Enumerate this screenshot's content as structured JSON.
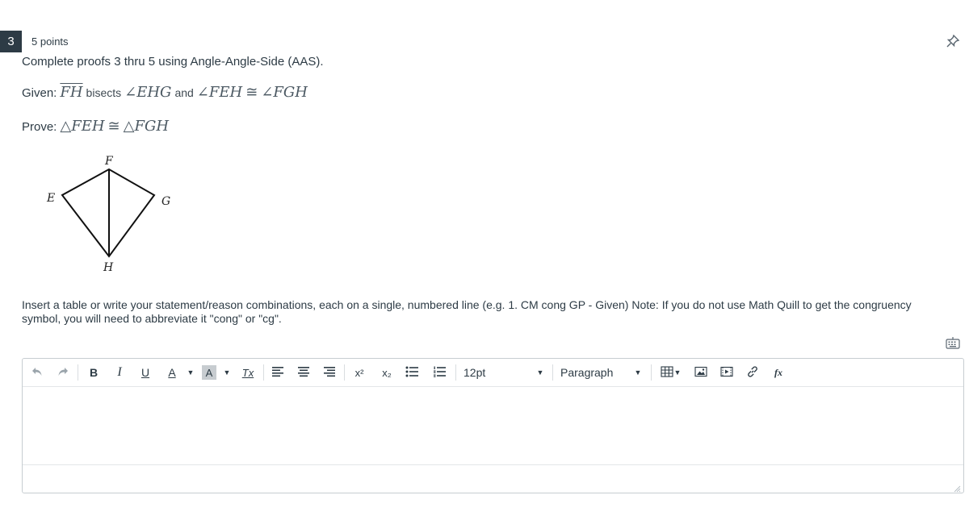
{
  "question": {
    "number": "3",
    "points": "5 points",
    "title": "Complete proofs 3 thru 5 using Angle-Angle-Side (AAS).",
    "given": {
      "label": "Given:",
      "segment": "FH",
      "word_bisects": "bisects",
      "angle1": "∠EHG",
      "word_and": "and",
      "angle2": "∠FEH",
      "congruent": "≅",
      "angle3": "∠FGH"
    },
    "prove": {
      "label": "Prove:",
      "tri1": "△FEH",
      "congruent": "≅",
      "tri2": "△FGH"
    },
    "diagram_labels": {
      "F": "F",
      "E": "E",
      "G": "G",
      "H": "H"
    },
    "instructions": "Insert a table or write your statement/reason combinations, each on a single, numbered line (e.g. 1. CM cong GP - Given)  Note: If you do not use Math Quill to get the congruency symbol, you will need to abbreviate it \"cong\" or \"cg\"."
  },
  "editor": {
    "toolbar": {
      "bold": "B",
      "italic": "I",
      "underline": "U",
      "text_color": "A",
      "bg_color": "A",
      "clear_format": "Tx",
      "superscript": "x²",
      "subscript": "x₂",
      "font_size": "12pt",
      "paragraph": "Paragraph",
      "equation": "fx"
    },
    "content": ""
  }
}
